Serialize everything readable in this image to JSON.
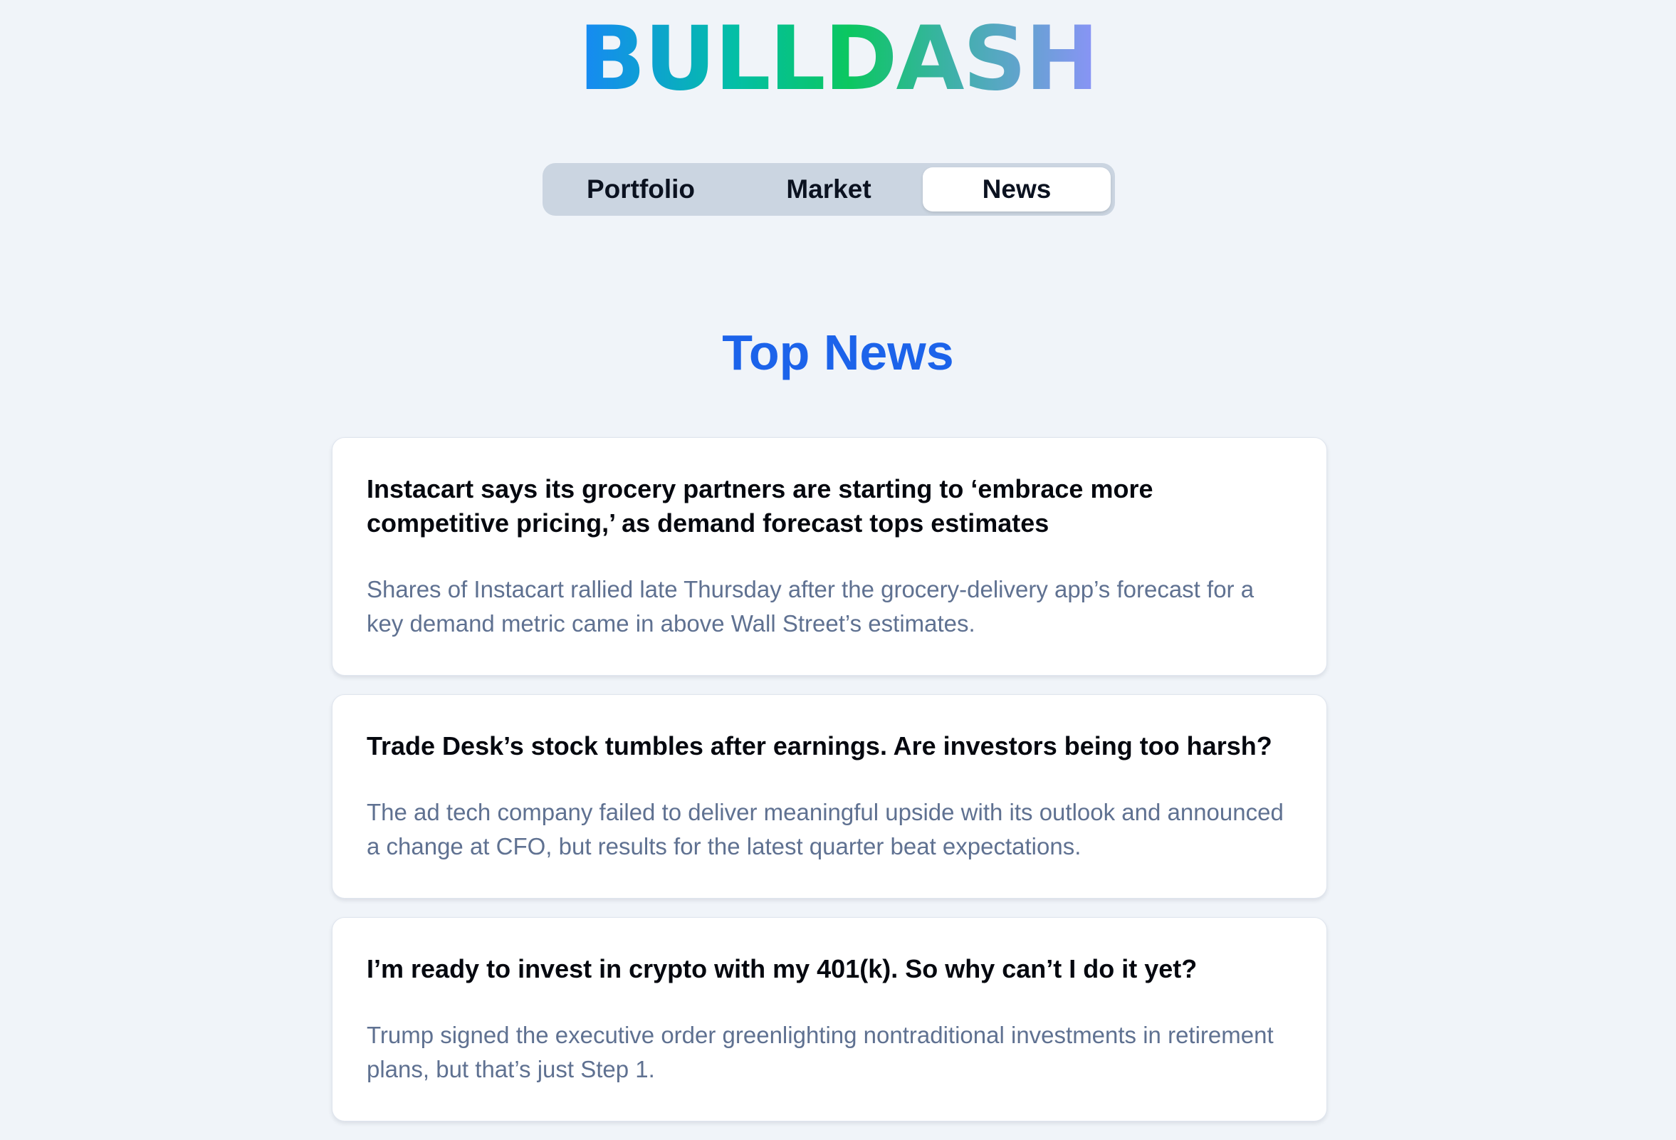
{
  "app": {
    "logo": "BULLDASH"
  },
  "nav": {
    "tabs": [
      {
        "label": "Portfolio",
        "active": false
      },
      {
        "label": "Market",
        "active": false
      },
      {
        "label": "News",
        "active": true
      }
    ]
  },
  "main": {
    "title": "Top News",
    "articles": [
      {
        "headline": "Instacart says its grocery partners are starting to ‘embrace more competitive pricing,’ as demand forecast tops estimates",
        "summary": "Shares of Instacart rallied late Thursday after the grocery-delivery app’s forecast for a key demand metric came in above Wall Street’s estimates."
      },
      {
        "headline": "Trade Desk’s stock tumbles after earnings. Are investors being too harsh?",
        "summary": "The ad tech company failed to deliver meaningful upside with its outlook and announced a change at CFO, but results for the latest quarter beat expectations."
      },
      {
        "headline": "I’m ready to invest in crypto with my 401(k). So why can’t I do it yet?",
        "summary": "Trump signed the executive order greenlighting nontraditional investments in retirement plans, but that’s just Step 1."
      }
    ]
  },
  "colors": {
    "background": "#f0f4f9",
    "accent": "#1c63ea",
    "tab_track": "#cbd5e1",
    "summary_text": "#5f7191"
  }
}
